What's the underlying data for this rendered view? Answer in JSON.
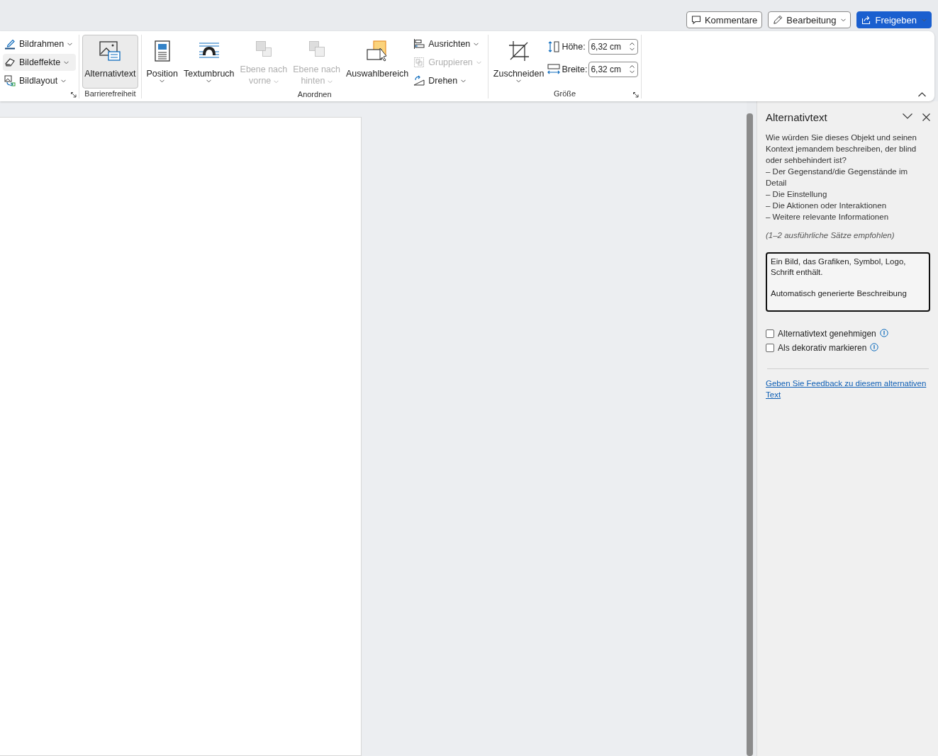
{
  "header_buttons": [
    {
      "kind": "comments",
      "label": "Kommentare",
      "dropdown": false
    },
    {
      "kind": "editing",
      "label": "Bearbeitung",
      "dropdown": true
    },
    {
      "kind": "share",
      "label": "Freigeben",
      "dropdown": true
    }
  ],
  "ribbon_groups": [
    {
      "launcher": true,
      "items": [
        {
          "kind": "stack",
          "buttons": [
            {
              "label": "Bildrahmen",
              "dropdown": true,
              "disabled": false,
              "hovered": false
            },
            {
              "label": "Bildeffekte",
              "dropdown": true,
              "disabled": false,
              "hovered": true
            },
            {
              "label": "Bildlayout",
              "dropdown": true,
              "disabled": false,
              "hovered": false
            }
          ]
        }
      ]
    },
    {
      "label": "Barrierefreiheit",
      "launcher": false,
      "items": [
        {
          "kind": "large",
          "label_lines": [
            "Alternativtext"
          ],
          "dropdown": false,
          "disabled": false,
          "selected": true
        }
      ]
    },
    {
      "label": "Anordnen",
      "launcher": false,
      "items": [
        {
          "kind": "large",
          "label_lines": [
            "Position"
          ],
          "dropdown": true,
          "disabled": false,
          "selected": false
        },
        {
          "kind": "large",
          "label_lines": [
            "Textumbruch"
          ],
          "dropdown": true,
          "disabled": false,
          "selected": false
        },
        {
          "kind": "large",
          "label_lines": [
            "Ebene nach",
            "vorne"
          ],
          "dropdown": true,
          "disabled": true,
          "selected": false
        },
        {
          "kind": "large",
          "label_lines": [
            "Ebene nach",
            "hinten"
          ],
          "dropdown": true,
          "disabled": true,
          "selected": false
        },
        {
          "kind": "large",
          "label_lines": [
            "Auswahlbereich"
          ],
          "dropdown": false,
          "disabled": false,
          "selected": false
        },
        {
          "kind": "stack",
          "buttons": [
            {
              "label": "Ausrichten",
              "dropdown": true,
              "disabled": false,
              "hovered": false
            },
            {
              "label": "Gruppieren",
              "dropdown": true,
              "disabled": true,
              "hovered": false
            },
            {
              "label": "Drehen",
              "dropdown": true,
              "disabled": false,
              "hovered": false
            }
          ]
        }
      ]
    },
    {
      "label": "Größe",
      "launcher": true,
      "items": [
        {
          "kind": "large",
          "label_lines": [
            "Zuschneiden"
          ],
          "dropdown": true,
          "disabled": false,
          "selected": false
        },
        {
          "kind": "size",
          "fields": [
            {
              "label": "Höhe:",
              "value": "6,32 cm"
            },
            {
              "label": "Breite:",
              "value": "6,32 cm"
            }
          ]
        }
      ]
    }
  ],
  "pane": {
    "title": "Alternativtext",
    "description": [
      "Wie würden Sie dieses Objekt und seinen Kontext jemandem beschreiben, der blind oder sehbehindert ist?",
      "– Der Gegenstand/die Gegenstände im Detail",
      "– Die Einstellung",
      "– Die Aktionen oder Interaktionen",
      "– Weitere relevante Informationen"
    ],
    "hint": "(1–2 ausführliche Sätze empfohlen)",
    "alt_text": "Ein Bild, das Grafiken, Symbol, Logo, Schrift enthält.\n\nAutomatisch generierte Beschreibung",
    "checkboxes": [
      {
        "label": "Alternativtext genehmigen",
        "checked": false
      },
      {
        "label": "Als dekorativ markieren",
        "checked": false
      }
    ],
    "feedback_link": "Geben Sie Feedback zu diesem alternativen Text"
  }
}
